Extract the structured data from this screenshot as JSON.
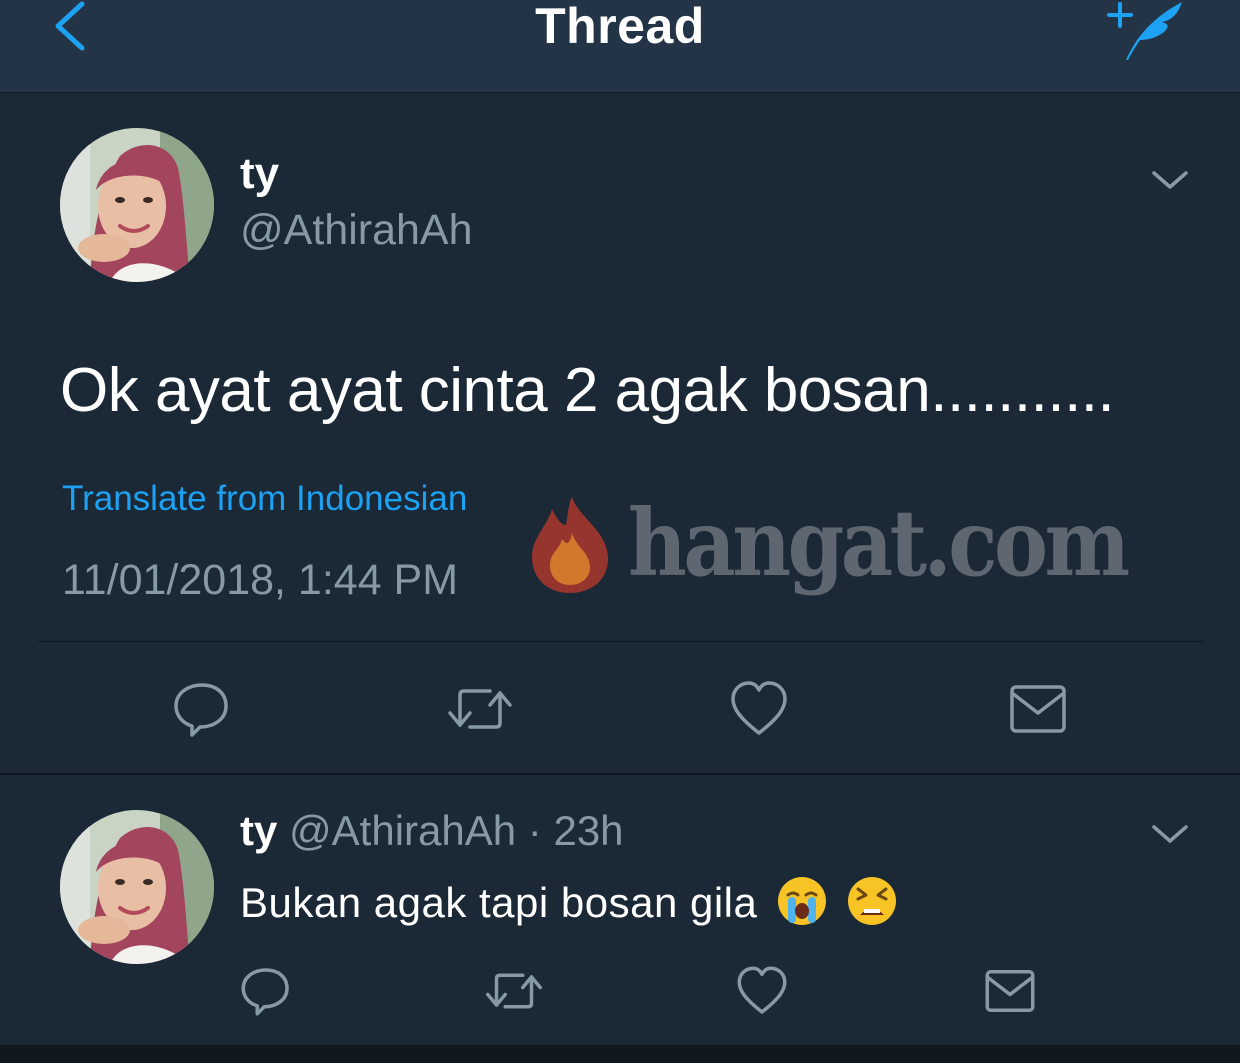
{
  "header": {
    "title": "Thread",
    "back_icon": "chevron-left-icon",
    "compose_icon": "compose-quill-icon",
    "accent_color": "#1da1f2"
  },
  "main_tweet": {
    "display_name": "ty",
    "handle": "@AthirahAh",
    "text": "Ok ayat ayat cinta 2 agak bosan...........",
    "translate_label": "Translate from Indonesian",
    "timestamp": "11/01/2018, 1:44 PM",
    "actions": [
      "reply-icon",
      "retweet-icon",
      "like-icon",
      "share-mail-icon"
    ]
  },
  "watermark": {
    "text": "hangat.com"
  },
  "reply_tweet": {
    "display_name": "ty",
    "handle": "@AthirahAh",
    "separator": "·",
    "time_ago": "23h",
    "text": "Bukan agak tapi bosan gila",
    "emojis": [
      "loudly-crying-face",
      "tired-face"
    ],
    "actions": [
      "reply-icon",
      "retweet-icon",
      "like-icon",
      "share-mail-icon"
    ]
  },
  "colors": {
    "background": "#1b2836",
    "header_bg": "#243447",
    "secondary_text": "#8899a6",
    "link": "#1da1f2"
  }
}
